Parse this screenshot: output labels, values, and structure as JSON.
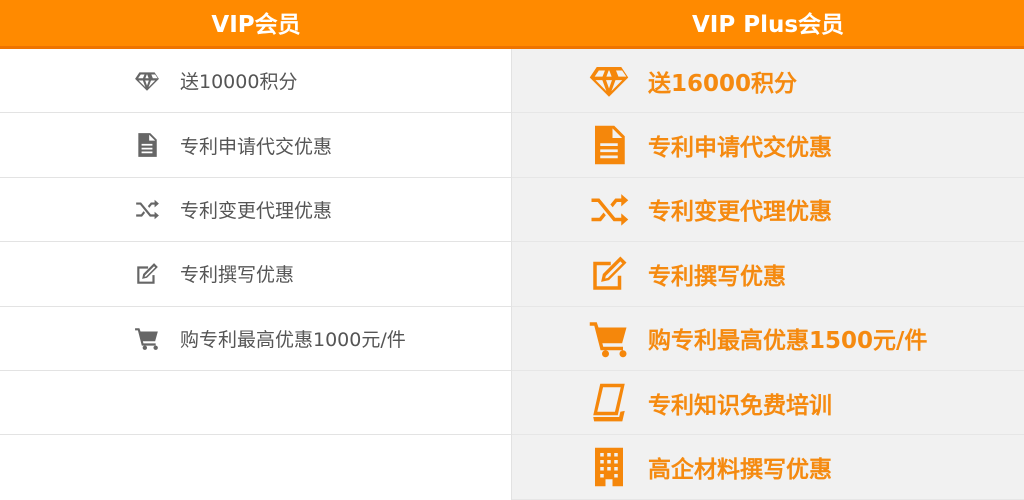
{
  "header": {
    "vip_title": "VIP会员",
    "vip_plus_title": "VIP Plus会员"
  },
  "vip": {
    "items": [
      {
        "icon": "diamond-icon",
        "label": "送10000积分"
      },
      {
        "icon": "document-icon",
        "label": "专利申请代交优惠"
      },
      {
        "icon": "shuffle-icon",
        "label": "专利变更代理优惠"
      },
      {
        "icon": "edit-icon",
        "label": "专利撰写优惠"
      },
      {
        "icon": "cart-icon",
        "label": "购专利最高优惠1000元/件"
      }
    ]
  },
  "vip_plus": {
    "items": [
      {
        "icon": "diamond-icon",
        "label": "送16000积分"
      },
      {
        "icon": "document-icon",
        "label": "专利申请代交优惠"
      },
      {
        "icon": "shuffle-icon",
        "label": "专利变更代理优惠"
      },
      {
        "icon": "edit-icon",
        "label": "专利撰写优惠"
      },
      {
        "icon": "cart-icon",
        "label": "购专利最高优惠1500元/件"
      },
      {
        "icon": "book-icon",
        "label": "专利知识免费培训"
      },
      {
        "icon": "building-icon",
        "label": "高企材料撰写优惠"
      }
    ]
  },
  "colors": {
    "header_bg": "#ff8a00",
    "accent": "#f5870b",
    "left_text": "#555555",
    "left_icon": "#666666",
    "right_bg": "#f1f1f1"
  }
}
